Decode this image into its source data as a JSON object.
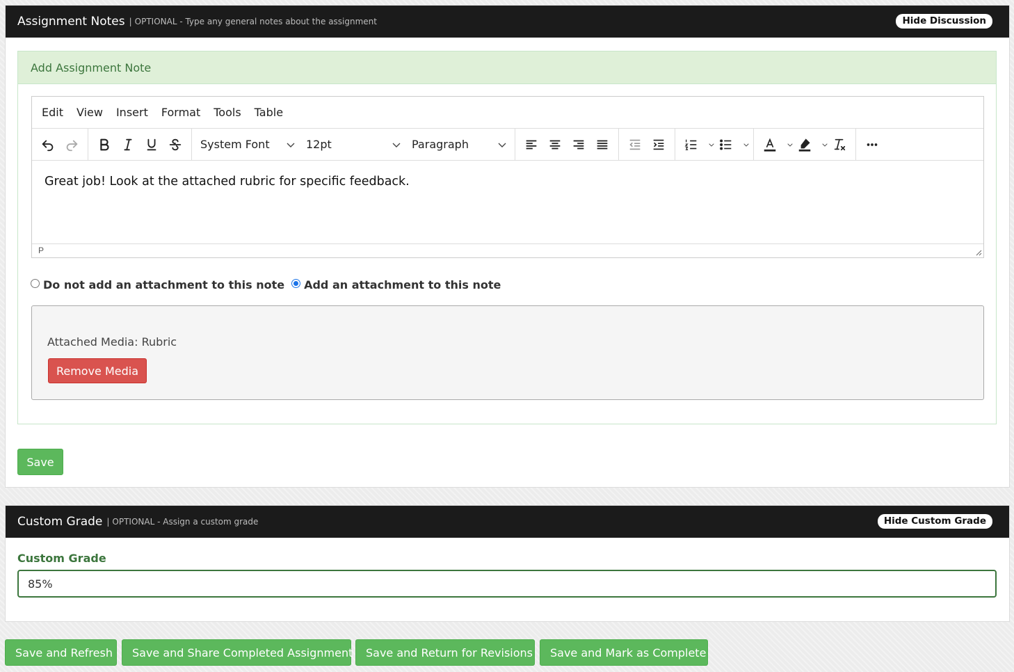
{
  "assignment_notes": {
    "title": "Assignment Notes",
    "separator": "|",
    "subtitle": "OPTIONAL - Type any general notes about the assignment",
    "toggle_label": "Hide Discussion",
    "card_title": "Add Assignment Note",
    "editor": {
      "menu": [
        "Edit",
        "View",
        "Insert",
        "Format",
        "Tools",
        "Table"
      ],
      "font_family": "System Font",
      "font_size": "12pt",
      "block_format": "Paragraph",
      "content": "Great job! Look at the attached rubric for specific feedback.",
      "status_path": "P"
    },
    "radio_no_attachment": "Do not add an attachment to this note",
    "radio_add_attachment": "Add an attachment to this note",
    "attached_media": "Attached Media: Rubric",
    "remove_media_label": "Remove Media",
    "save_label": "Save"
  },
  "custom_grade": {
    "title": "Custom Grade",
    "separator": "|",
    "subtitle": "OPTIONAL - Assign a custom grade",
    "toggle_label": "Hide Custom Grade",
    "field_label": "Custom Grade",
    "value": "85%"
  },
  "actions": {
    "save_refresh": "Save and Refresh",
    "save_share": "Save and Share Completed Assignment",
    "save_return": "Save and Return for Revisions",
    "save_complete": "Save and Mark as Complete"
  },
  "colors": {
    "header_bg": "#1b1b1b",
    "success_green": "#5cb85c",
    "danger_red": "#d9534f",
    "card_green_bg": "#dff0d8",
    "label_green": "#3c763d"
  }
}
